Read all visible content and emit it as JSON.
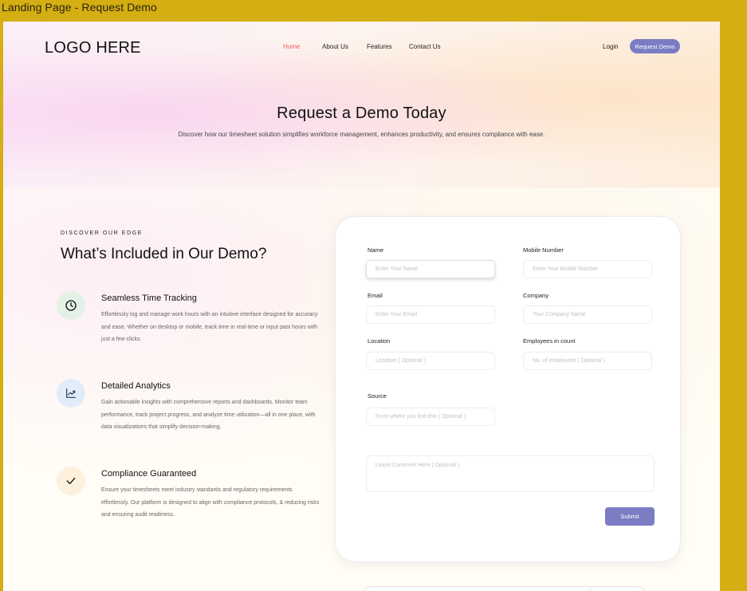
{
  "frame": {
    "title": "Landing Page - Request Demo"
  },
  "header": {
    "logo": "LOGO HERE",
    "nav": [
      "Home",
      "About Us",
      "Features",
      "Contact Us"
    ],
    "login": "Login",
    "cta": "Request Demo"
  },
  "hero": {
    "title": "Request a Demo Today",
    "subtitle": "Discover how our timesheet solution simplifies workforce management, enhances productivity, and ensures compliance with ease."
  },
  "section": {
    "eyebrow": "DISCOVER OUR EDGE",
    "title": "What’s Included in Our Demo?",
    "features": [
      {
        "icon": "clock-icon",
        "title": "Seamless Time Tracking",
        "desc": "Effortlessly log and manage work hours with  an intuitive interface designed for accuracy and ease. Whether on desktop or mobile, track time in real-time or input past hours with just a few clicks."
      },
      {
        "icon": "chart-trend-icon",
        "title": "Detailed Analytics",
        "desc": "Gain actionable insights with comprehensive reports and dashboards. Monitor team performance, track project progress, and analyze time utilization—all in one place, with data visualizations that simplify decision-making."
      },
      {
        "icon": "checkmark-icon",
        "title": "Compliance Guaranteed",
        "desc": "Ensure your timesheets meet industry standards and regulatory requirements effortlessly. Our platform is designed to align with compliance protocols, & reducing risks and ensuring audit readiness."
      }
    ]
  },
  "form": {
    "name_label": "Name",
    "name_placeholder": "Enter Your Name",
    "mobile_label": "Mobile Number",
    "mobile_placeholder": "Enter Your Mobile Number",
    "email_label": "Email",
    "email_placeholder": "Enter Your Email",
    "company_label": "Company",
    "company_placeholder": "Your Company Name",
    "location_label": "Location",
    "location_placeholder": "Location ( Optional )",
    "employees_label": "Employees in count",
    "employees_placeholder": "No .of employees ( Optional )",
    "source_label": "Source",
    "source_placeholder": "From where you find this ( Optional )",
    "comment_placeholder": "Leave Comment Here ( Optional )",
    "submit": "Submit"
  },
  "colors": {
    "accent": "#7a7cc4",
    "nav_active": "#ef5a5a",
    "frame_bg": "#d4ae12"
  }
}
